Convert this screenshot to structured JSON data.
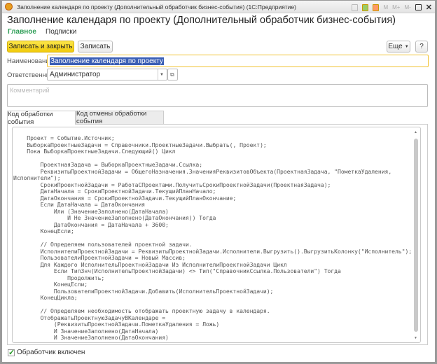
{
  "window": {
    "title": "Заполнение календаря по проекту (Дополнительный обработчик бизнес-события)  (1С:Предприятие)",
    "controls": [
      "M",
      "M+",
      "M-"
    ]
  },
  "form": {
    "title": "Заполнение календаря по проекту (Дополнительный обработчик бизнес-события)",
    "nav": [
      {
        "label": "Главное",
        "active": true
      },
      {
        "label": "Подписки",
        "active": false
      }
    ],
    "toolbar": {
      "save_close": "Записать и закрыть",
      "save": "Записать",
      "more": "Еще",
      "help": "?"
    },
    "name_label": "Наименование:",
    "name_value": "Заполнение календаря по проекту",
    "resp_label": "Ответственный:",
    "resp_value": "Администратор",
    "comment_placeholder": "Комментарий",
    "tabs": [
      {
        "label": "Код обработки события",
        "active": true
      },
      {
        "label": "Код отмены обработки события",
        "active": false
      }
    ],
    "code": "    Проект = Событие.Источник;\n    ВыборкаПроектныеЗадачи = Справочники.ПроектныеЗадачи.Выбрать(, Проект);\n    Пока ВыборкаПроектныеЗадачи.Следующий() Цикл\n\n        ПроектнаяЗадача = ВыборкаПроектныеЗадачи.Ссылка;\n        РеквизитыПроектнойЗадачи = ОбщегоНазначения.ЗначенияРеквизитовОбъекта(ПроектнаяЗадача, \"ПометкаУдаления,\nИсполнители\");\n        СрокиПроектнойЗадачи = РаботаСПроектами.ПолучитьСрокиПроектнойЗадачи(ПроектнаяЗадача);\n        ДатаНачала = СрокиПроектнойЗадачи.ТекущийПланНачало;\n        ДатаОкончания = СрокиПроектнойЗадачи.ТекущийПланОкончание;\n        Если ДатаНачала = ДатаОкончания\n            Или (ЗначениеЗаполнено(ДатаНачала)\n                И Не ЗначениеЗаполнено(ДатаОкончания)) Тогда\n            ДатаОкончания = ДатаНачала + 3600;\n        КонецЕсли;\n\n        // Определяем пользователей проектной задачи.\n        ИсполнителиПроектнойЗадачи = РеквизитыПроектнойЗадачи.Исполнители.Выгрузить().ВыгрузитьКолонку(\"Исполнитель\");\n        ПользователиПроектнойЗадачи = Новый Массив;\n        Для Каждого ИсполнительПроектнойЗадачи Из ИсполнителиПроектнойЗадачи Цикл\n            Если ТипЗнч(ИсполнительПроектнойЗадачи) <> Тип(\"СправочникСсылка.Пользователи\") Тогда\n                Продолжить;\n            КонецЕсли;\n            ПользователиПроектнойЗадачи.Добавить(ИсполнительПроектнойЗадачи);\n        КонецЦикла;\n\n        // Определяем необходимость отображать проектную задачу в календаря.\n        ОтображатьПроектнуюЗадачуВКалендаре =\n            (РеквизитыПроектнойЗадачи.ПометкаУдаления = Ложь)\n            И ЗначениеЗаполнено(ДатаНачала)\n            И ЗначениеЗаполнено(ДатаОкончания)",
    "enabled_label": "Обработчик включен",
    "enabled": true,
    "accent": "#2f9e57"
  }
}
